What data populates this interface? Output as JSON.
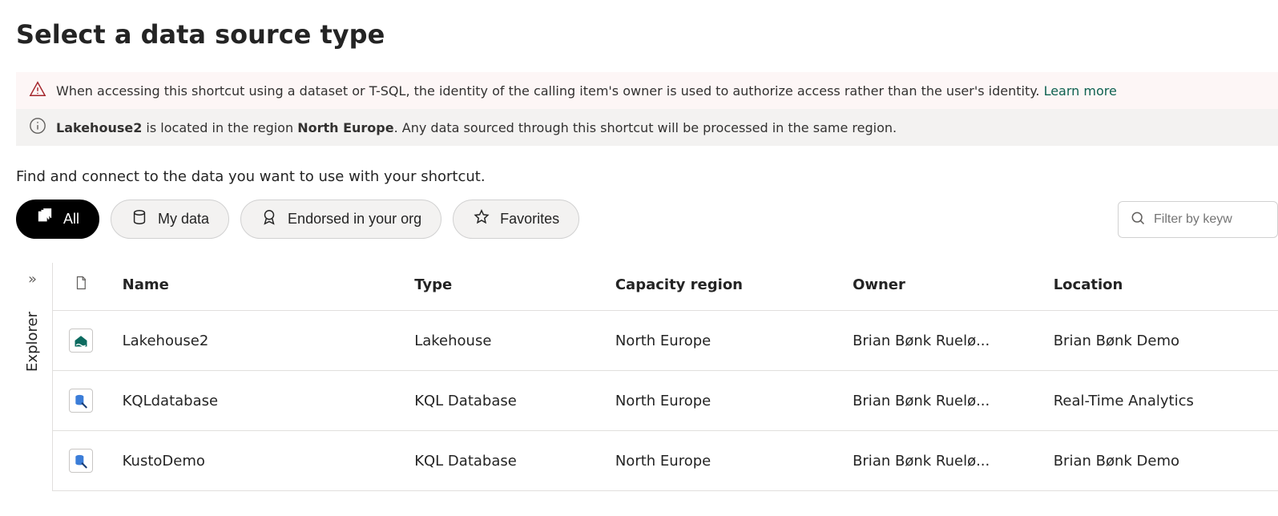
{
  "header": {
    "title": "Select a data source type"
  },
  "banners": {
    "warning_text": "When accessing this shortcut using a dataset or T-SQL, the identity of the calling item's owner is used to authorize access rather than the user's identity. ",
    "warning_link": "Learn more",
    "info_prefix": "",
    "info_lakehouse": "Lakehouse2",
    "info_mid": " is located in the region ",
    "info_region": "North Europe",
    "info_suffix": ". Any data sourced through this shortcut will be processed in the same region."
  },
  "subhead": "Find and connect to the data you want to use with your shortcut.",
  "filters": {
    "all": "All",
    "mydata": "My data",
    "endorsed": "Endorsed in your org",
    "favorites": "Favorites",
    "search_placeholder": "Filter by keyw"
  },
  "explorer": {
    "label": "Explorer"
  },
  "table": {
    "headers": {
      "icon": "",
      "name": "Name",
      "type": "Type",
      "region": "Capacity region",
      "owner": "Owner",
      "location": "Location"
    },
    "rows": [
      {
        "icon_kind": "lakehouse",
        "name": "Lakehouse2",
        "type": "Lakehouse",
        "region": "North Europe",
        "owner": "Brian Bønk Ruelø...",
        "location": "Brian Bønk Demo"
      },
      {
        "icon_kind": "kql",
        "name": "KQLdatabase",
        "type": "KQL Database",
        "region": "North Europe",
        "owner": "Brian Bønk Ruelø...",
        "location": "Real-Time Analytics"
      },
      {
        "icon_kind": "kql",
        "name": "KustoDemo",
        "type": "KQL Database",
        "region": "North Europe",
        "owner": "Brian Bønk Ruelø...",
        "location": "Brian Bønk Demo"
      }
    ]
  }
}
